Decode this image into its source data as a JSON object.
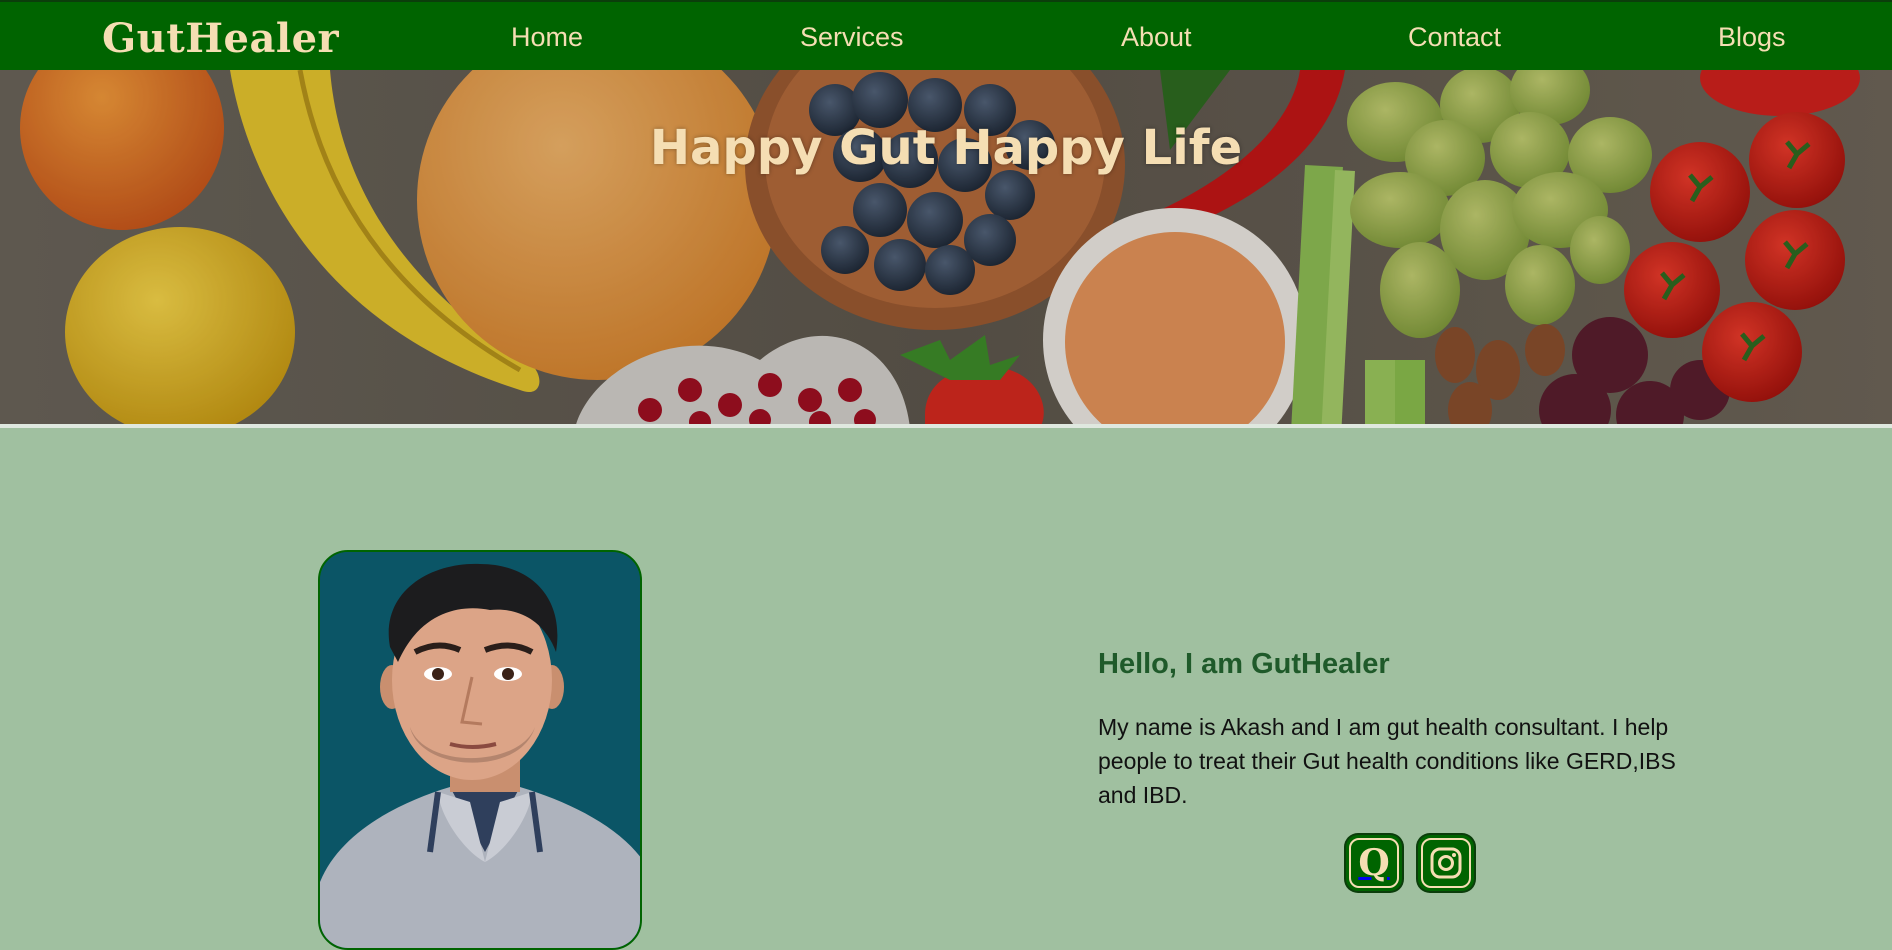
{
  "nav": {
    "logo": "GutHealer",
    "links": [
      "Home",
      "Services",
      "About",
      "Contact",
      "Blogs"
    ]
  },
  "hero": {
    "title": "Happy Gut Happy Life",
    "background_image": "fresh fruits and vegetables on wooden table"
  },
  "about": {
    "photo": "portrait of Akash",
    "heading": "Hello, I am GutHealer",
    "text": "My name is Akash and I am gut health consultant. I help people to treat their Gut health conditions like GERD,IBS and IBD.",
    "social": [
      {
        "icon": "quora-icon"
      },
      {
        "icon": "instagram-icon"
      }
    ]
  },
  "colors": {
    "nav_bg": "#006400",
    "accent_text": "#f5deb3",
    "section_bg": "#a0c0a0",
    "heading": "#1f5a2a",
    "photo_bg": "#0b5566"
  }
}
